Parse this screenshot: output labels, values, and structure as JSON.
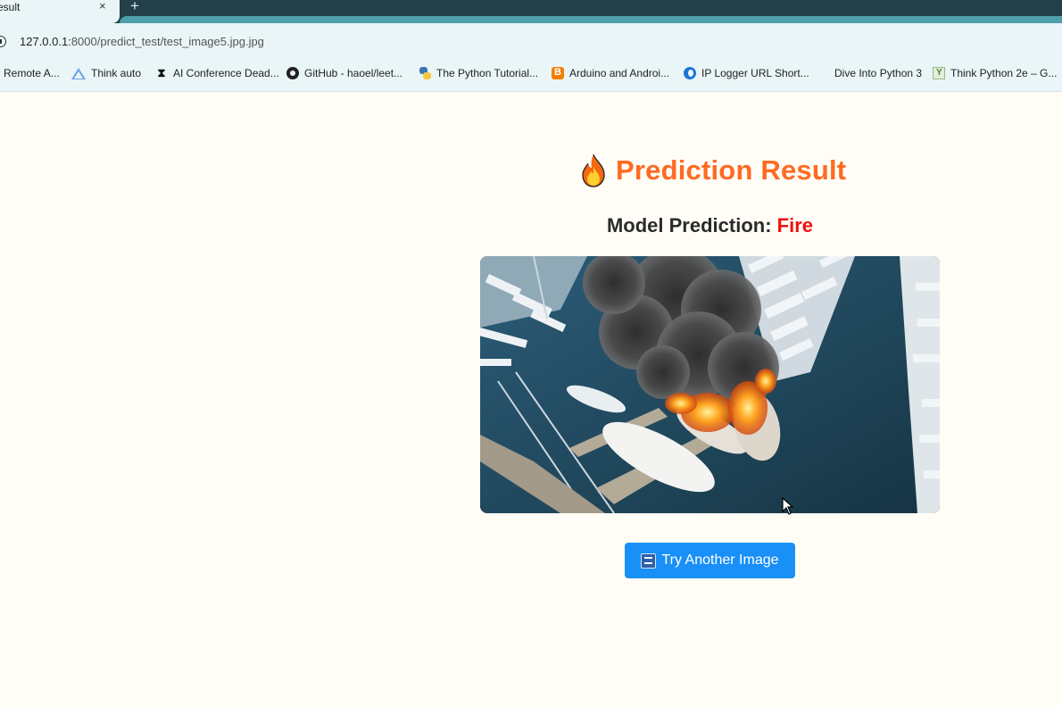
{
  "browser": {
    "tab_title": "esult",
    "tab_close": "×",
    "new_tab": "+",
    "url_host": "127.0.0.1:",
    "url_path": "8000/predict_test/test_image5.jpg.jpg",
    "bookmarks": [
      {
        "label": "Remote A...",
        "icon": "none"
      },
      {
        "label": "Think auto",
        "icon": "triangle-icon"
      },
      {
        "label": "AI Conference Dead...",
        "icon": "hourglass-icon"
      },
      {
        "label": "GitHub - haoel/leet...",
        "icon": "github-icon"
      },
      {
        "label": "The Python Tutorial...",
        "icon": "python-icon"
      },
      {
        "label": "Arduino and Androi...",
        "icon": "blogger-icon"
      },
      {
        "label": "IP Logger URL Short...",
        "icon": "iplogger-icon"
      },
      {
        "label": "Dive Into Python 3",
        "icon": "none"
      },
      {
        "label": "Think Python 2e – G...",
        "icon": "thinkpython-icon"
      }
    ]
  },
  "page": {
    "heading": "Prediction Result",
    "prediction_label": "Model Prediction: ",
    "prediction_value": "Fire",
    "button_label": "Try Another Image",
    "colors": {
      "heading": "#ff6a22",
      "prediction_value": "#f01010",
      "button": "#1990f7",
      "background": "#fffdf6"
    }
  }
}
